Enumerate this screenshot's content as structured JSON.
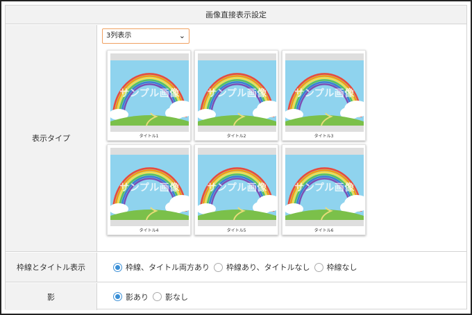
{
  "header": {
    "title": "画像直接表示設定"
  },
  "display_type": {
    "label": "表示タイプ",
    "select_value": "3列表示",
    "cards": [
      {
        "watermark": "サンプル画像",
        "caption": "タイトル1"
      },
      {
        "watermark": "サンプル画像",
        "caption": "タイトル2"
      },
      {
        "watermark": "サンプル画像",
        "caption": "タイトル3"
      },
      {
        "watermark": "サンプル画像",
        "caption": "タイトル4"
      },
      {
        "watermark": "サンプル画像",
        "caption": "タイトル5"
      },
      {
        "watermark": "サンプル画像",
        "caption": "タイトル6"
      }
    ]
  },
  "frame_title": {
    "label": "枠線とタイトル表示",
    "options": [
      {
        "label": "枠線、タイトル両方あり",
        "selected": true
      },
      {
        "label": "枠線あり、タイトルなし",
        "selected": false
      },
      {
        "label": "枠線なし",
        "selected": false
      }
    ]
  },
  "shadow": {
    "label": "影",
    "options": [
      {
        "label": "影あり",
        "selected": true
      },
      {
        "label": "影なし",
        "selected": false
      }
    ]
  },
  "colors": {
    "accent": "#3a8fd6",
    "select_border": "#f0a060",
    "label_bg": "#f2f2f2",
    "border": "#d4d4d4"
  }
}
